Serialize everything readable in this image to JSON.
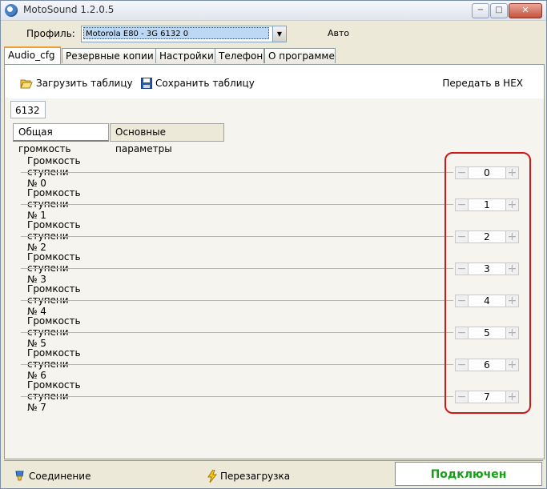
{
  "window": {
    "title": "MotoSound 1.2.0.5",
    "minimize": "−",
    "maximize": "□",
    "close": "✕"
  },
  "profile": {
    "label": "Профиль:",
    "value": "Motorola E80 -  3G 6132 0",
    "mode": "Авто"
  },
  "tabs": [
    {
      "label": "Audio_cfg",
      "active": true
    },
    {
      "label": "Резервные копии"
    },
    {
      "label": "Настройки"
    },
    {
      "label": "Телефон"
    },
    {
      "label": "О программе"
    }
  ],
  "toolbar": {
    "load": "Загрузить таблицу",
    "save": "Сохранить таблицу",
    "hex": "Передать в HEX"
  },
  "table_id": "6132",
  "subtabs": [
    {
      "label": "Общая громкость",
      "active": true
    },
    {
      "label": "Основные параметры"
    }
  ],
  "volumes": [
    {
      "label": "Громкость ступени № 0",
      "value": "0"
    },
    {
      "label": "Громкость ступени № 1",
      "value": "1"
    },
    {
      "label": "Громкость ступени № 2",
      "value": "2"
    },
    {
      "label": "Громкость ступени № 3",
      "value": "3"
    },
    {
      "label": "Громкость ступени № 4",
      "value": "4"
    },
    {
      "label": "Громкость ступени № 5",
      "value": "5"
    },
    {
      "label": "Громкость ступени № 6",
      "value": "6"
    },
    {
      "label": "Громкость ступени № 7",
      "value": "7"
    }
  ],
  "spin_minus": "−",
  "spin_plus": "+",
  "status": {
    "connection": "Соединение",
    "reboot": "Перезагрузка",
    "state": "Подключен"
  },
  "colors": {
    "connected": "#13a013",
    "highlight": "#d01818"
  }
}
